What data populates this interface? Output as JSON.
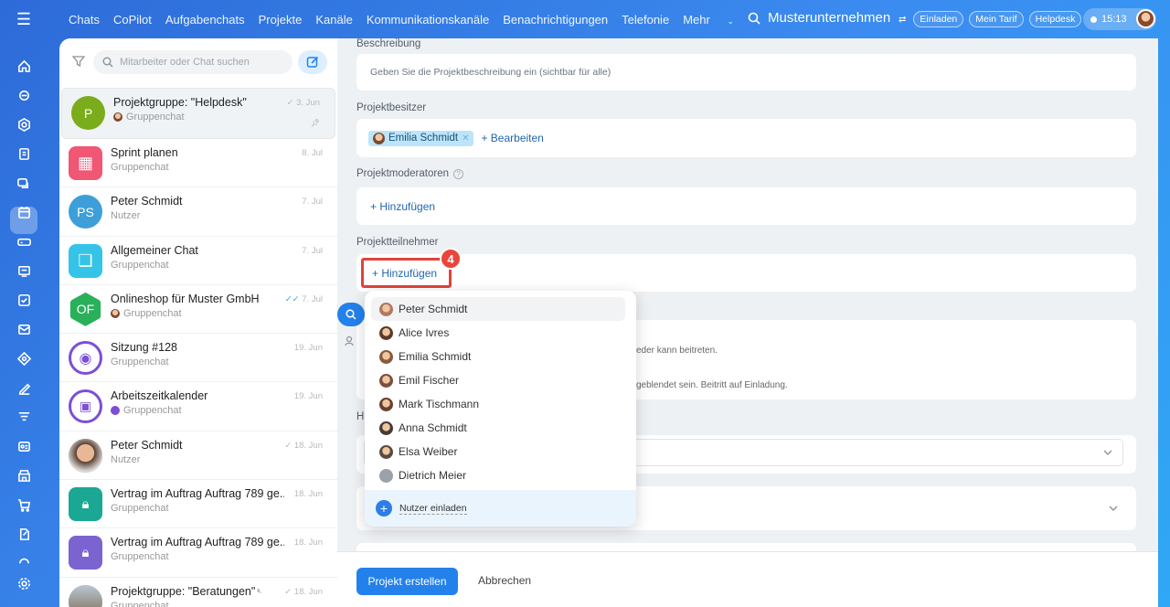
{
  "topbar": {
    "nav": [
      "Chats",
      "CoPilot",
      "Aufgabenchats",
      "Projekte",
      "Kanäle",
      "Kommunikationskanäle",
      "Benachrichtigungen",
      "Telefonie",
      "Mehr"
    ],
    "company": "Musterunternehmen",
    "buttons": {
      "invite": "Einladen",
      "plan": "Mein Tarif",
      "helpdesk": "Helpdesk"
    },
    "time": "15:13"
  },
  "chatlist": {
    "search_placeholder": "Mitarbeiter oder Chat suchen",
    "items": [
      {
        "name": "Projektgruppe: \"Helpdesk\"",
        "sub": "Gruppenchat",
        "date": "3. Jun",
        "color": "#7bac1c",
        "initials": "P"
      },
      {
        "name": "Sprint planen",
        "sub": "Gruppenchat",
        "date": "8. Jul",
        "color": "#f05774",
        "initials": ""
      },
      {
        "name": "Peter Schmidt",
        "sub": "Nutzer",
        "date": "7. Jul",
        "color": "#3d9fd9",
        "initials": "PS"
      },
      {
        "name": "Allgemeiner Chat",
        "sub": "Gruppenchat",
        "date": "7. Jul",
        "color": "#35c4e8",
        "initials": ""
      },
      {
        "name": "Onlineshop für Muster GmbH",
        "sub": "Gruppenchat",
        "date": "7. Jul",
        "color": "#29b05a",
        "initials": "OF"
      },
      {
        "name": "Sitzung #128",
        "sub": "Gruppenchat",
        "date": "19. Jun",
        "color": "#7b4fd6",
        "initials": ""
      },
      {
        "name": "Arbeitszeitkalender",
        "sub": "Gruppenchat",
        "date": "19. Jun",
        "color": "#7b4fd6",
        "initials": ""
      },
      {
        "name": "Peter Schmidt",
        "sub": "Nutzer",
        "date": "18. Jun",
        "color": "#a57b5e",
        "initials": ""
      },
      {
        "name": "Vertrag im Auftrag Auftrag 789 ge...",
        "sub": "Gruppenchat",
        "date": "18. Jun",
        "color": "#1aa895",
        "initials": ""
      },
      {
        "name": "Vertrag im Auftrag Auftrag 789 ge...",
        "sub": "Gruppenchat",
        "date": "18. Jun",
        "color": "#7b63d0",
        "initials": ""
      },
      {
        "name": "Projektgruppe: \"Beratungen\"",
        "sub": "Gruppenchat",
        "date": "18. Jun",
        "color": "#8aa0b0",
        "initials": ""
      }
    ]
  },
  "form": {
    "description_label": "Beschreibung",
    "description_placeholder": "Geben Sie die Projektbeschreibung ein (sichtbar für alle)",
    "owner_label": "Projektbesitzer",
    "owner_name": "Emilia Schmidt",
    "edit_link": "+ Bearbeiten",
    "moderators_label": "Projektmoderatoren",
    "add_link": "+ Hinzufügen",
    "participants_label": "Projektteilnehmer",
    "participants_add": "+ Hinzufügen",
    "step_badge": "4",
    "hint_h": "H",
    "info1": "eder kann beitreten.",
    "info2": "geblendet sein. Beitritt auf Einladung."
  },
  "dropdown": {
    "users": [
      "Peter Schmidt",
      "Alice Ivres",
      "Emilia Schmidt",
      "Emil Fischer",
      "Mark Tischmann",
      "Anna Schmidt",
      "Elsa Weiber",
      "Dietrich Meier"
    ],
    "invite": "Nutzer einladen"
  },
  "footer": {
    "create": "Projekt erstellen",
    "cancel": "Abbrechen"
  },
  "colors": {
    "accent": "#2381eb",
    "highlight": "#e0433a"
  }
}
